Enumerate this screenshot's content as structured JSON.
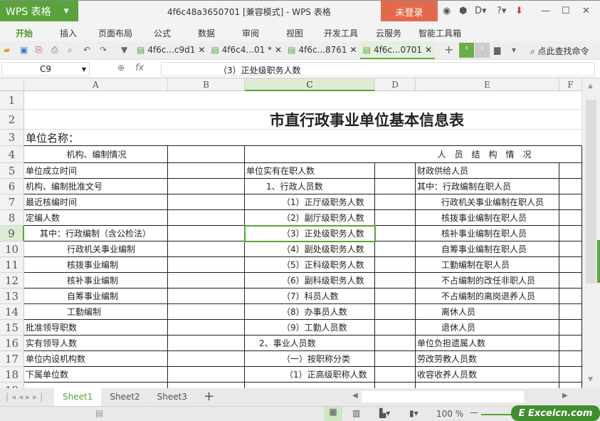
{
  "app": {
    "logo": "WPS 表格",
    "window_title": "4f6c48a3650701 [兼容模式] - WPS 表格",
    "login": "未登录"
  },
  "menu": [
    "开始",
    "插入",
    "页面布局",
    "公式",
    "数据",
    "审阅",
    "视图",
    "开发工具",
    "云服务",
    "智能工具箱"
  ],
  "doc_tabs": [
    {
      "label": "4f6c...c9d1",
      "active": false
    },
    {
      "label": "4f6c4...01 *",
      "active": false
    },
    {
      "label": "4f6c...8761",
      "active": false
    },
    {
      "label": "4f6c...0701",
      "active": true
    }
  ],
  "search_command": "点此查找命令",
  "formula_bar": {
    "cell_ref": "C9",
    "fx": "fx",
    "value": "（3）正处级职务人数"
  },
  "columns": [
    "A",
    "B",
    "C",
    "D",
    "E",
    "F"
  ],
  "selected_cell": "C9",
  "sheet": {
    "title": "市直行政事业单位基本信息表",
    "unit_name_label": "单位名称：",
    "section_left": "机构、编制情况",
    "section_right": "人　员　结　构　情　况",
    "rows": [
      {
        "num": "1",
        "a": "",
        "c": "",
        "e": ""
      },
      {
        "num": "2",
        "a": "",
        "c": "",
        "e": ""
      },
      {
        "num": "3",
        "a": "",
        "c": "",
        "e": ""
      },
      {
        "num": "4",
        "a": "",
        "c": "",
        "e": ""
      },
      {
        "num": "5",
        "a": "单位成立时间",
        "c": "单位实有在职人数",
        "e": "财政供给人员"
      },
      {
        "num": "6",
        "a": "机构、编制批准文号",
        "c": "1、行政人员数",
        "e": "其中：行政编制在职人员"
      },
      {
        "num": "7",
        "a": "最近核编时间",
        "c": "（1）正厅级职务人数",
        "e": "行政机关事业编制在职人员"
      },
      {
        "num": "8",
        "a": "定编人数",
        "c": "（2）副厅级职务人数",
        "e": "核拨事业编制在职人员"
      },
      {
        "num": "9",
        "a": "其中：行政编制（含公检法）",
        "c": "（3）正处级职务人数",
        "e": "核补事业编制在职人员"
      },
      {
        "num": "10",
        "a": "行政机关事业编制",
        "c": "（4）副处级职务人数",
        "e": "自筹事业编制在职人员"
      },
      {
        "num": "11",
        "a": "核拨事业编制",
        "c": "（5）正科级职务人数",
        "e": "工勤编制在职人员"
      },
      {
        "num": "12",
        "a": "核补事业编制",
        "c": "（6）副科级职务人数",
        "e": "不占编制的改任非职人员"
      },
      {
        "num": "13",
        "a": "自筹事业编制",
        "c": "（7）科员人数",
        "e": "不占编制的离岗退养人员"
      },
      {
        "num": "14",
        "a": "工勤编制",
        "c": "（8）办事员人数",
        "e": "离休人员"
      },
      {
        "num": "15",
        "a": "批准领导职数",
        "c": "（9）工勤人员数",
        "e": "退休人员"
      },
      {
        "num": "16",
        "a": "实有领导人数",
        "c": "2、事业人员数",
        "e": "单位负担遗属人数"
      },
      {
        "num": "17",
        "a": "单位内设机构数",
        "c": "（一）按职称分类",
        "e": "劳改劳教人员数"
      },
      {
        "num": "18",
        "a": "下属单位数",
        "c": "（1）正高级职称人数",
        "e": "收容收养人员数"
      },
      {
        "num": "19",
        "a": "",
        "c": "",
        "e": ""
      }
    ]
  },
  "sheet_tabs": [
    {
      "label": "Sheet1",
      "active": true
    },
    {
      "label": "Sheet2",
      "active": false
    },
    {
      "label": "Sheet3",
      "active": false
    }
  ],
  "status": {
    "zoom": "100 %"
  },
  "watermark": "Excelcn.com",
  "colors": {
    "accent": "#5aa33c",
    "login": "#e4694c"
  }
}
